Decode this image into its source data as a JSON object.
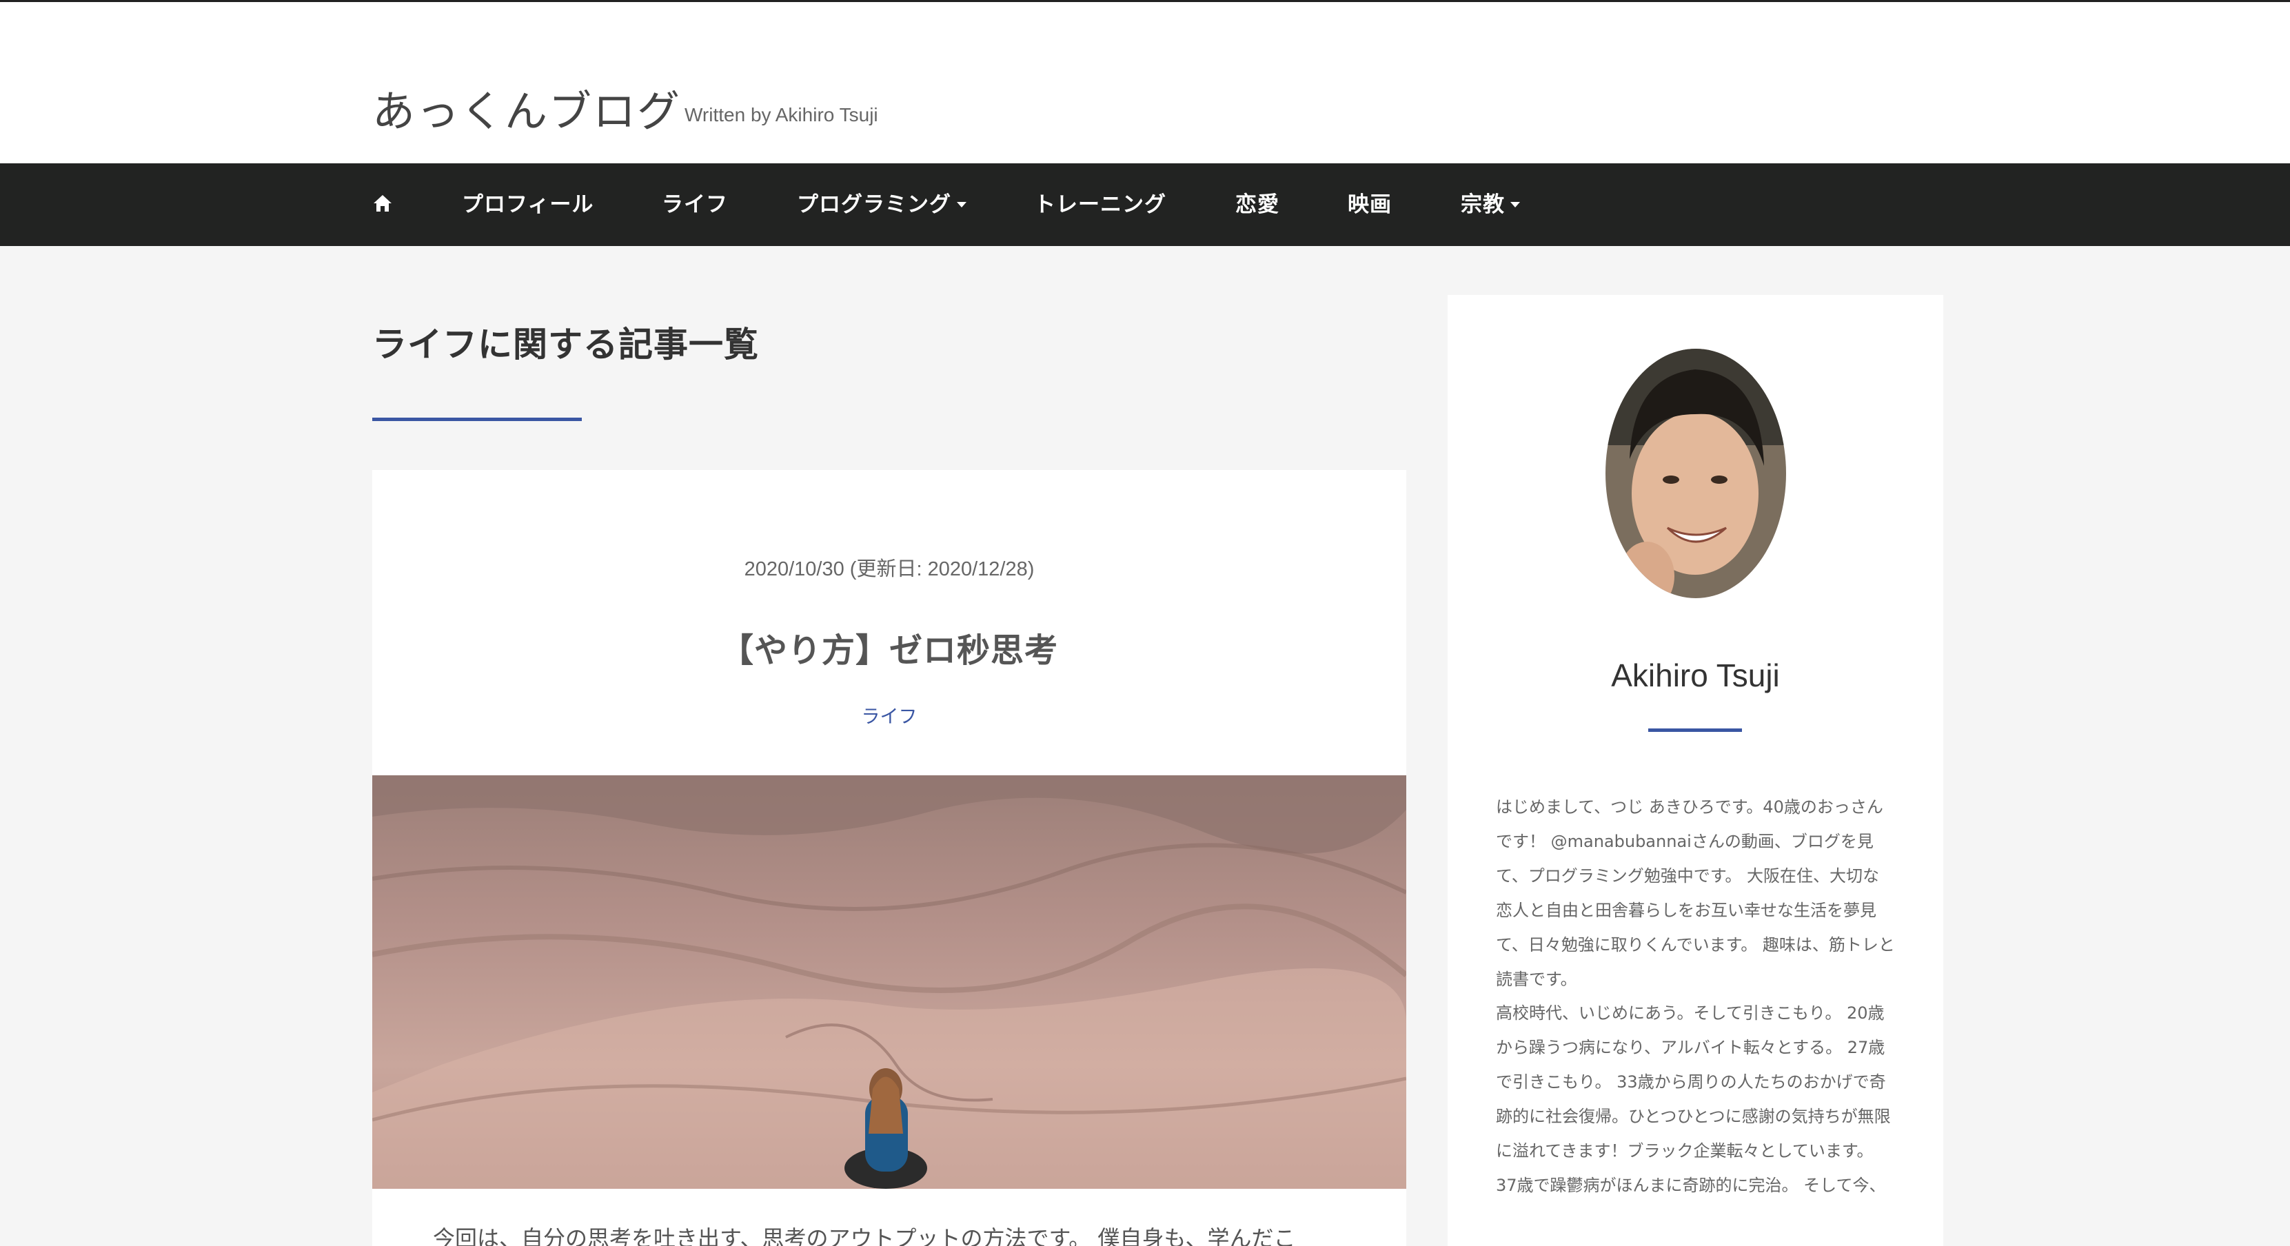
{
  "site": {
    "title": "あっくんブログ",
    "subtitle": "Written by Akihiro Tsuji"
  },
  "nav": {
    "home_icon": "home-icon",
    "items": [
      {
        "label": "プロフィール",
        "dropdown": false
      },
      {
        "label": "ライフ",
        "dropdown": false
      },
      {
        "label": "プログラミング",
        "dropdown": true
      },
      {
        "label": "トレーニング",
        "dropdown": false
      },
      {
        "label": "恋愛",
        "dropdown": false
      },
      {
        "label": "映画",
        "dropdown": false
      },
      {
        "label": "宗教",
        "dropdown": true
      }
    ]
  },
  "main": {
    "heading": "ライフに関する記事一覧",
    "post": {
      "date": "2020/10/30 (更新日: 2020/12/28)",
      "title": "【やり方】ゼロ秒思考",
      "category": "ライフ",
      "image": "desert-dunes-person-sitting",
      "excerpt": "今回は、自分の思考を吐き出す、思考のアウトプットの方法です。 僕自身も、学んだこ"
    }
  },
  "sidebar": {
    "avatar": "author-avatar",
    "author_name": "Akihiro Tsuji",
    "bio_1": [
      "はじめまして、つじ あきひろです。40歳のおっさん",
      "です！ @manabubannaiさんの動画、ブログを見",
      "て、プログラミング勉強中です。 大阪在住、大切な",
      "恋人と自由と田舎暮らしをお互い幸せな生活を夢見",
      "て、日々勉強に取りくんでいます。 趣味は、筋トレと",
      "読書です。"
    ],
    "bio_2": [
      "高校時代、いじめにあう。そして引きこもり。 20歳",
      "から躁うつ病になり、アルバイト転々とする。 27歳",
      "で引きこもり。 33歳から周りの人たちのおかげで奇",
      "跡的に社会復帰。ひとつひとつに感謝の気持ちが無限",
      "に溢れてきます！ブラック企業転々としています。",
      "37歳で躁鬱病がほんまに奇跡的に完治。 そして今、"
    ]
  },
  "colors": {
    "accent": "#3a56a3",
    "nav_bg": "#222322",
    "page_bg": "#f5f5f5"
  }
}
